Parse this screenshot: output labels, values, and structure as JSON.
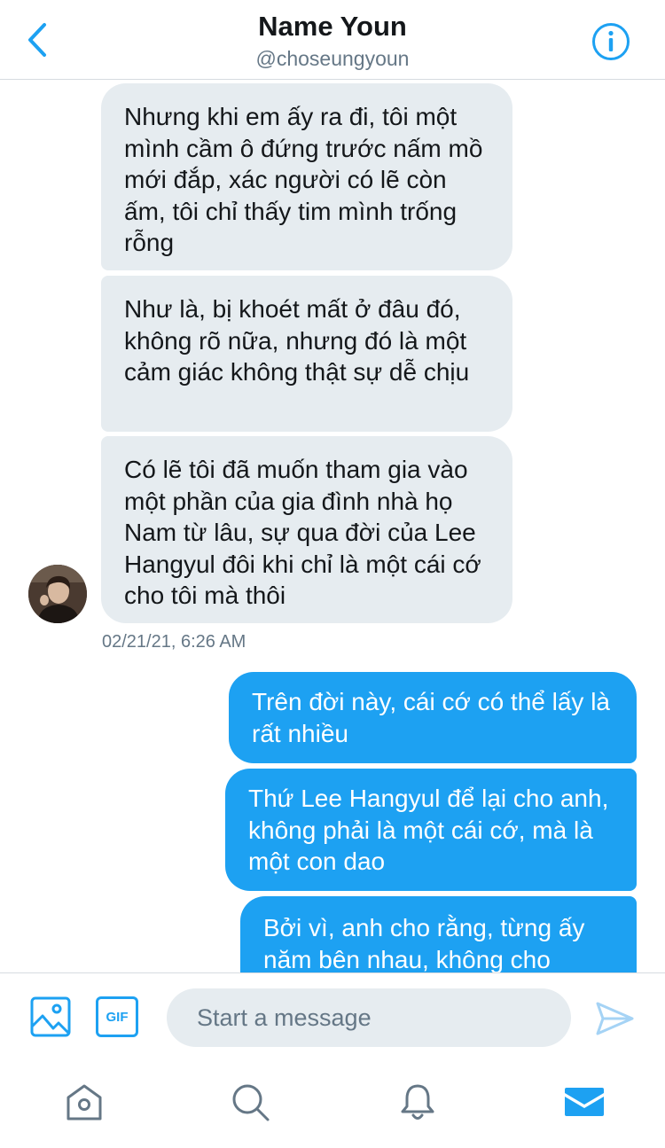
{
  "header": {
    "title": "Name Youn",
    "handle": "@choseungyoun"
  },
  "messages": {
    "received": [
      "Nhưng khi em ấy ra đi, tôi một mình cầm ô đứng trước nấm mồ mới đắp, xác người có lẽ còn ấm, tôi chỉ thấy tim mình trống rỗng",
      "Như là, bị khoét mất ở đâu đó, không rõ nữa, nhưng đó là một cảm giác không thật sự dễ chịu",
      "Có lẽ tôi đã muốn tham gia vào một phần của gia đình nhà họ Nam từ lâu, sự qua đời của Lee Hangyul đôi khi chỉ là một cái cớ cho tôi mà thôi"
    ],
    "timestamp": "02/21/21, 6:26 AM",
    "sent": [
      "Trên đời này, cái cớ có thể lấy là rất nhiều",
      "Thứ Lee Hangyul để lại cho anh, không phải là một cái cớ, mà là một con dao",
      "Bởi vì, anh cho rằng, từng ấy năm bên nhau, không cho"
    ]
  },
  "composer": {
    "gif_label": "GIF",
    "placeholder": "Start a message",
    "icons": [
      "image-icon",
      "gif-icon",
      "send-icon"
    ]
  },
  "nav": {
    "icons": [
      "home-icon",
      "search-icon",
      "notifications-icon",
      "messages-icon"
    ]
  },
  "colors": {
    "accent": "#1da1f2",
    "received_bubble": "#e6ecf0",
    "secondary_text": "#657786"
  }
}
